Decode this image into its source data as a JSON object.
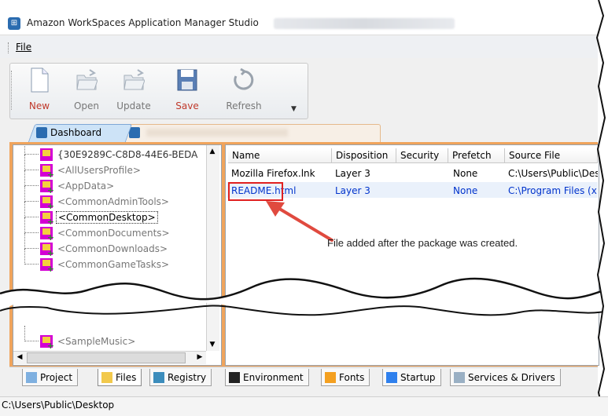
{
  "window": {
    "title": "Amazon WorkSpaces Application Manager Studio",
    "app_icon_glyph": "⊞"
  },
  "menu": {
    "file_label": "File"
  },
  "toolbar": {
    "new_label": "New",
    "open_label": "Open",
    "update_label": "Update",
    "save_label": "Save",
    "refresh_label": "Refresh"
  },
  "tabs": {
    "dashboard_label": "Dashboard"
  },
  "tree": {
    "items": [
      {
        "label": "{30E9289C-C8D8-44E6-BEDA",
        "style": "normal"
      },
      {
        "label": "<AllUsersProfile>",
        "style": "grey"
      },
      {
        "label": "<AppData>",
        "style": "grey"
      },
      {
        "label": "<CommonAdminTools>",
        "style": "grey"
      },
      {
        "label": "<CommonDesktop>",
        "style": "selected"
      },
      {
        "label": "<CommonDocuments>",
        "style": "grey"
      },
      {
        "label": "<CommonDownloads>",
        "style": "grey"
      },
      {
        "label": "<CommonGameTasks>",
        "style": "grey"
      }
    ],
    "last_visible": "<SampleMusic>"
  },
  "list": {
    "columns": [
      "Name",
      "Disposition",
      "Security",
      "Prefetch",
      "Source File"
    ],
    "rows": [
      [
        "Mozilla Firefox.lnk",
        "Layer 3",
        "",
        "None",
        "C:\\Users\\Public\\Des"
      ],
      [
        "README.html",
        "Layer 3",
        "",
        "None",
        "C:\\Program Files (x"
      ]
    ]
  },
  "annotation": {
    "callout": "File added after the package was created."
  },
  "bottom_tabs": [
    "Project",
    "Files",
    "Registry",
    "Environment",
    "Fonts",
    "Startup",
    "Services & Drivers"
  ],
  "status": {
    "path": "C:\\Users\\Public\\Desktop"
  },
  "colors": {
    "accent": "#f0a45c",
    "selection_text": "#0033cc",
    "highlight_box": "#e02020"
  }
}
